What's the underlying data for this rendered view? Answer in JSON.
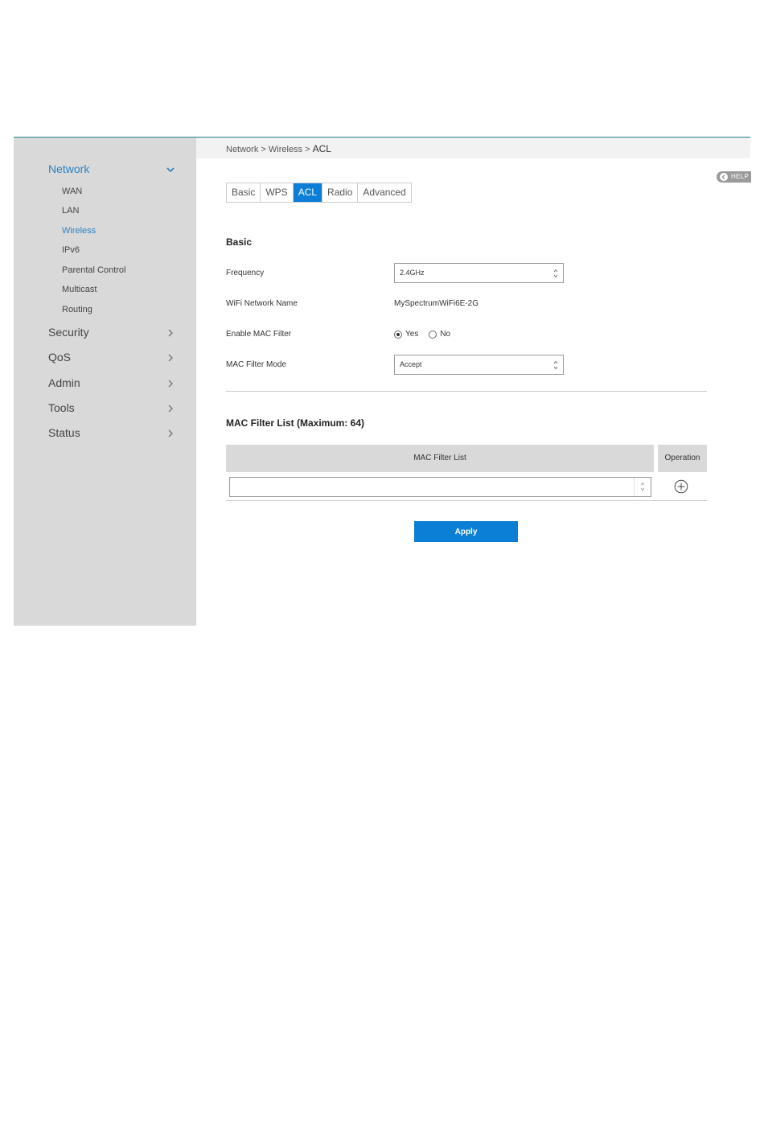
{
  "breadcrumb": {
    "part1": "Network",
    "sep1": " > ",
    "part2": "Wireless",
    "sep2": " > ",
    "current": "ACL"
  },
  "help": {
    "label": "HELP"
  },
  "sidebar": {
    "network": {
      "label": "Network"
    },
    "sub_items": [
      "WAN",
      "LAN",
      "Wireless",
      "IPv6",
      "Parental Control",
      "Multicast",
      "Routing"
    ],
    "security": {
      "label": "Security"
    },
    "qos": {
      "label": "QoS"
    },
    "admin": {
      "label": "Admin"
    },
    "tools": {
      "label": "Tools"
    },
    "status": {
      "label": "Status"
    }
  },
  "tabs": [
    "Basic",
    "WPS",
    "ACL",
    "Radio",
    "Advanced"
  ],
  "basic": {
    "title": "Basic",
    "frequency_label": "Frequency",
    "frequency_value": "2.4GHz",
    "ssid_label": "WiFi Network Name",
    "ssid_value": "MySpectrumWiFi6E-2G",
    "mac_filter_label": "Enable MAC Filter",
    "yes_label": "Yes",
    "no_label": "No",
    "mode_label": "MAC Filter Mode",
    "mode_value": "Accept"
  },
  "mac_list": {
    "title": "MAC Filter List (Maximum: 64)",
    "col_list": "MAC Filter List",
    "col_operation": "Operation",
    "input_value": ""
  },
  "apply_label": "Apply",
  "colors": {
    "accent": "#0b7fd6",
    "sidebar_bg": "#d9d9d9",
    "active_nav": "#2b83c6"
  }
}
